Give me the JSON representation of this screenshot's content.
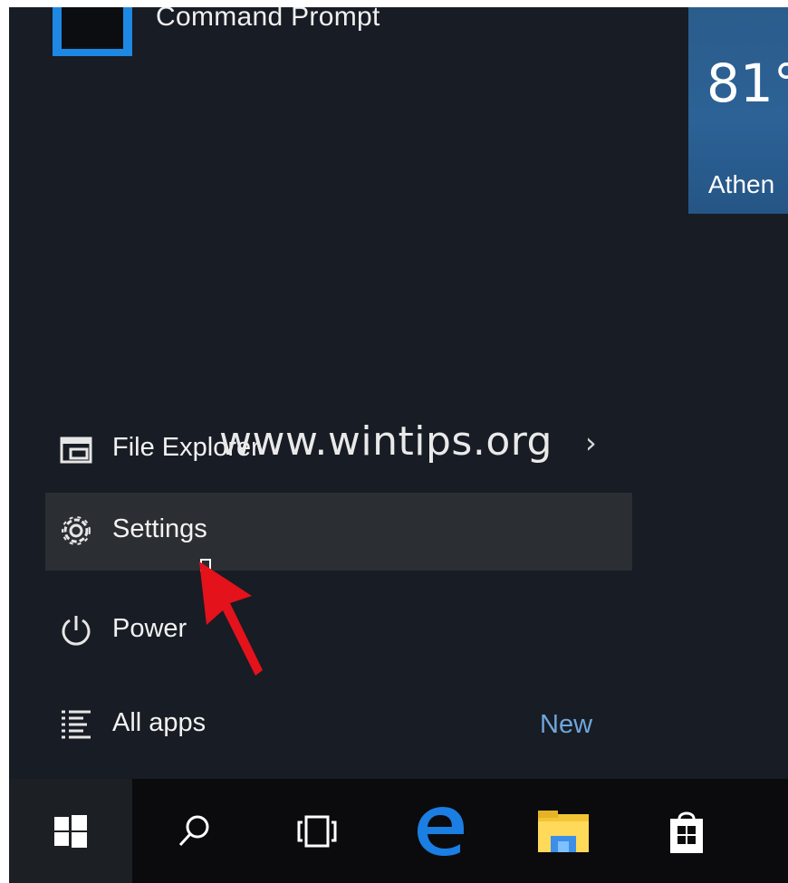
{
  "start_menu": {
    "pinned_app": {
      "label": "Command Prompt"
    },
    "weather_tile": {
      "temperature": "81°",
      "city": "Athen"
    },
    "items": [
      {
        "label": "File Explorer",
        "icon": "folder-icon"
      },
      {
        "label": "Settings",
        "icon": "gear-icon"
      },
      {
        "label": "Power",
        "icon": "power-icon"
      },
      {
        "label": "All apps",
        "icon": "list-icon",
        "badge": "New"
      }
    ],
    "chevron": "›",
    "watermark": "www.wintips.org"
  },
  "taskbar": {
    "buttons": [
      {
        "icon": "windows-logo-icon"
      },
      {
        "icon": "search-icon"
      },
      {
        "icon": "task-view-icon"
      },
      {
        "icon": "edge-browser-icon"
      },
      {
        "icon": "file-explorer-icon"
      },
      {
        "icon": "store-icon"
      }
    ]
  },
  "colors": {
    "accent": "#1e88e5",
    "menu_bg": "#181c24",
    "taskbar_bg": "#0b0b0d",
    "highlight": "#2b2e33",
    "new_badge": "#6fa6dc",
    "annotation_arrow": "#e3121b"
  }
}
